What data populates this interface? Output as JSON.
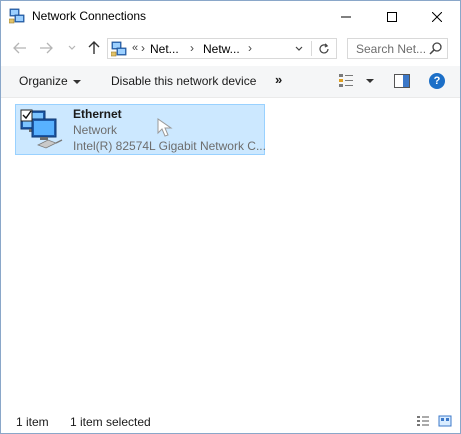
{
  "window": {
    "title": "Network Connections",
    "icon": "network-connections-icon"
  },
  "controls": {
    "minimize": "minimize-icon",
    "maximize": "maximize-icon",
    "close": "close-icon"
  },
  "nav": {
    "back": "back-arrow-icon",
    "forward": "forward-arrow-icon",
    "recent": "chevron-down-icon",
    "up": "up-arrow-icon"
  },
  "address": {
    "overflow": "«",
    "segments": [
      "Net...",
      "Netw..."
    ],
    "separators": [
      "›",
      "›",
      "›"
    ]
  },
  "search": {
    "placeholder": "Search Net..."
  },
  "toolbar": {
    "organize": "Organize",
    "disable": "Disable this network device",
    "more": "»"
  },
  "items": [
    {
      "name": "Ethernet",
      "status": "Network",
      "device": "Intel(R) 82574L Gigabit Network C..."
    }
  ],
  "status": {
    "count": "1 item",
    "selected": "1 item selected"
  },
  "colors": {
    "selection_bg": "#cce8ff",
    "selection_border": "#99d1ff",
    "accent": "#1c6fc7"
  }
}
